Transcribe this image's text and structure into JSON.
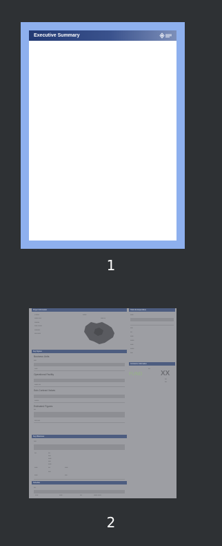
{
  "pages": [
    {
      "number": "1",
      "header_title": "Executive Summary",
      "selected": true,
      "accent_color": "#8eb0ee"
    },
    {
      "number": "2",
      "selected": false,
      "sections": {
        "top_left": "Project Information",
        "top_right": "Total Life Expenditure",
        "figures": "Key Figures",
        "sub1": "Business Units",
        "sub2": "Operational Facility",
        "sub3": "Sub-Contract Values",
        "sub4": "Estimated Figures",
        "key_milestones": "Key Milestones",
        "schedule": "Schedule",
        "funding": "Contractor Information",
        "fund_label": "FUND",
        "fund_value": "XX"
      }
    }
  ]
}
